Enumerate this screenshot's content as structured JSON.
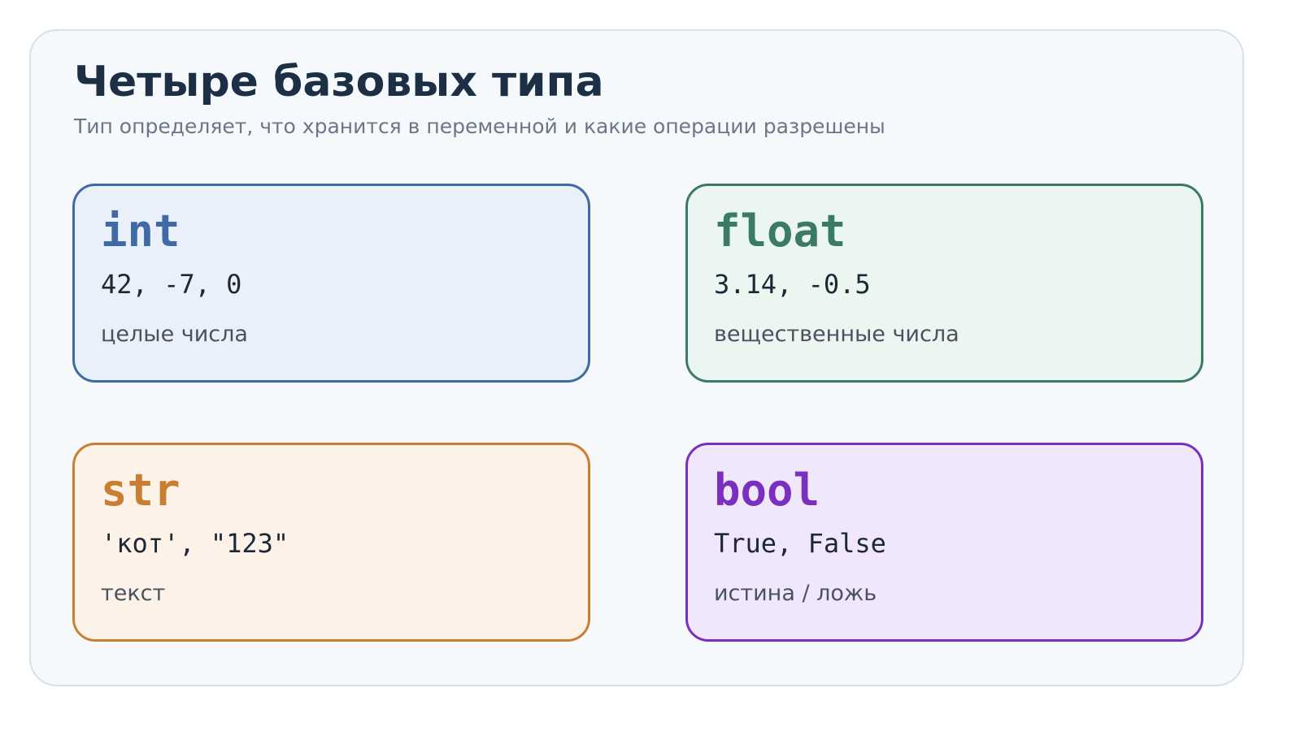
{
  "title": "Четыре базовых типа",
  "subtitle": "Тип определяет, что хранится в переменной и какие операции разрешены",
  "cards": [
    {
      "name": "int",
      "examples": "42, -7, 0",
      "description": "целые числа",
      "color": "#3f6aa6",
      "background": "#e9f0fa"
    },
    {
      "name": "float",
      "examples": "3.14, -0.5",
      "description": "вещественные числа",
      "color": "#3b7a66",
      "background": "#eaf6ef"
    },
    {
      "name": "str",
      "examples": "'кот', \"123\"",
      "description": "текст",
      "color": "#c97f32",
      "background": "#fcf2e7"
    },
    {
      "name": "bool",
      "examples": "True, False",
      "description": "истина / ложь",
      "color": "#7a2fbe",
      "background": "#f1e7fb"
    }
  ]
}
